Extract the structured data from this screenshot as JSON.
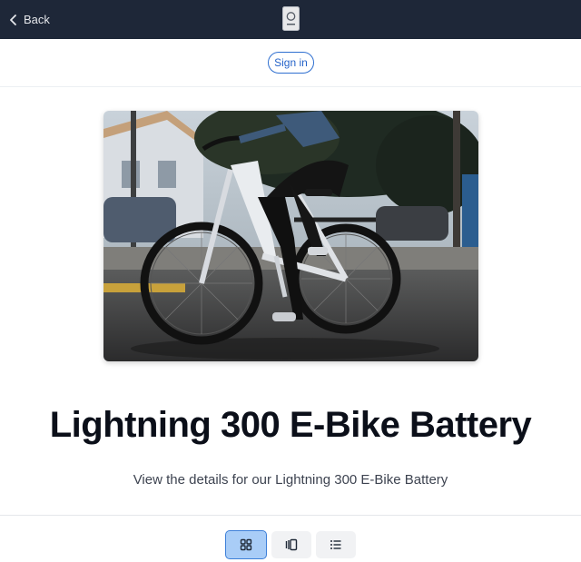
{
  "header": {
    "back_label": "Back",
    "back_icon": "chevron-left-icon",
    "logo_icon": "passport-logo-icon"
  },
  "auth": {
    "signin_label": "Sign in"
  },
  "product": {
    "image_alt": "E-bike rider",
    "title": "Lightning 300 E-Bike Battery",
    "subtitle": "View the details for our Lightning 300 E-Bike Battery"
  },
  "view_switcher": {
    "options": [
      {
        "icon": "grid-view-icon",
        "active": true
      },
      {
        "icon": "carousel-view-icon",
        "active": false
      },
      {
        "icon": "list-view-icon",
        "active": false
      }
    ]
  },
  "colors": {
    "header_bg": "#1e2738",
    "accent": "#2f6fd0",
    "active_view_bg": "#a9cdf7"
  }
}
